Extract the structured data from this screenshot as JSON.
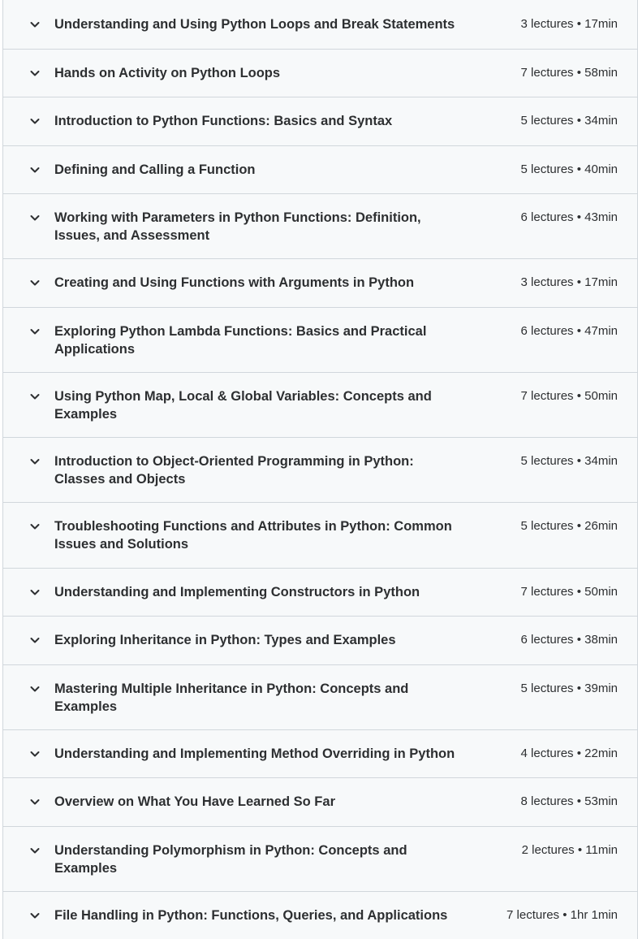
{
  "sections": [
    {
      "title": "Understanding and Using Python Loops and Break Statements",
      "meta": "3 lectures • 17min"
    },
    {
      "title": "Hands on Activity on Python Loops",
      "meta": "7 lectures • 58min"
    },
    {
      "title": "Introduction to Python Functions: Basics and Syntax",
      "meta": "5 lectures • 34min"
    },
    {
      "title": "Defining and Calling a Function",
      "meta": "5 lectures • 40min"
    },
    {
      "title": "Working with Parameters in Python Functions: Definition, Issues, and Assessment",
      "meta": "6 lectures • 43min"
    },
    {
      "title": "Creating and Using Functions with Arguments in Python",
      "meta": "3 lectures • 17min"
    },
    {
      "title": "Exploring Python Lambda Functions: Basics and Practical Applications",
      "meta": "6 lectures • 47min"
    },
    {
      "title": "Using Python Map, Local & Global Variables: Concepts and Examples",
      "meta": "7 lectures • 50min"
    },
    {
      "title": "Introduction to Object-Oriented Programming in Python: Classes and Objects",
      "meta": "5 lectures • 34min"
    },
    {
      "title": "Troubleshooting Functions and Attributes in Python: Common Issues and Solutions",
      "meta": "5 lectures • 26min"
    },
    {
      "title": "Understanding and Implementing Constructors in Python",
      "meta": "7 lectures • 50min"
    },
    {
      "title": "Exploring Inheritance in Python: Types and Examples",
      "meta": "6 lectures • 38min"
    },
    {
      "title": "Mastering Multiple Inheritance in Python: Concepts and Examples",
      "meta": "5 lectures • 39min"
    },
    {
      "title": "Understanding and Implementing Method Overriding in Python",
      "meta": "4 lectures • 22min"
    },
    {
      "title": "Overview on What You Have Learned So Far",
      "meta": "8 lectures • 53min"
    },
    {
      "title": "Understanding Polymorphism in Python: Concepts and Examples",
      "meta": "2 lectures • 11min"
    },
    {
      "title": "File Handling in Python: Functions, Queries, and Applications",
      "meta": "7 lectures • 1hr 1min"
    }
  ],
  "icons": {
    "expand": "chevron-down-icon"
  },
  "colors": {
    "row_background": "#f7f9fa",
    "border": "#d1d7dc",
    "text": "#2d2f31"
  }
}
